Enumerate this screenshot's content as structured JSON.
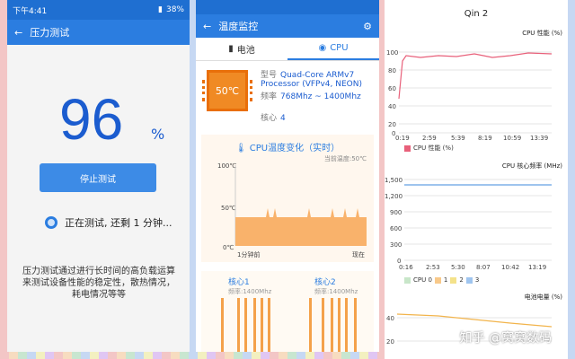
{
  "panel1": {
    "status_time": "下午4:41",
    "status_battery": "38%",
    "title": "压力测试",
    "progress_value": "96",
    "progress_unit": "%",
    "stop_label": "停止测试",
    "testing_text": "正在测试, 还剩 1 分钟...",
    "description": "压力测试通过进行长时间的高负载运算来测试设备性能的稳定性，散热情况，耗电情况等等"
  },
  "panel2": {
    "title": "温度监控",
    "tab_battery": "电池",
    "tab_cpu": "CPU",
    "chip_temp": "50℃",
    "model_label": "型号",
    "model_value": "Quad-Core ARMv7 Processor (VFPv4, NEON)",
    "freq_label": "频率",
    "freq_value": "768Mhz ~ 1400Mhz",
    "cores_label": "核心",
    "cores_value": "4",
    "temp_chart_title": "CPU温度变化（实时）",
    "current_temp": "当前温度:50℃",
    "y_top": "100℃",
    "y_mid": "50℃",
    "y_bot": "0℃",
    "x_left": "1分钟前",
    "x_right": "现在",
    "core1": "核心1",
    "core1_freq": "频率:1400Mhz",
    "core2": "核心2",
    "core2_freq": "频率:1400Mhz"
  },
  "panel3": {
    "title": "Qin 2",
    "chart1_title": "CPU 性能 (%)",
    "chart1_legend": "CPU 性能 (%)",
    "chart1_xticks": [
      "0:19",
      "2:59",
      "5:39",
      "8:19",
      "10:59",
      "13:39"
    ],
    "chart1_yticks": [
      "100",
      "80",
      "60",
      "40",
      "20",
      "0"
    ],
    "chart2_title": "CPU 核心频率 (MHz)",
    "chart2_xticks": [
      "0:16",
      "2:53",
      "5:30",
      "8:07",
      "10:42",
      "13:19"
    ],
    "chart2_yticks": [
      "1,500",
      "1,200",
      "900",
      "600",
      "300",
      "0"
    ],
    "chart2_legend": [
      "CPU 0",
      "1",
      "2",
      "3"
    ],
    "chart3_title": "电池电量 (%)",
    "chart3_yticks": [
      "40",
      "20"
    ],
    "watermark": "知乎 @窝窝数码"
  },
  "colors": {
    "accent": "#2b7de0",
    "chip": "#f08a24",
    "perf_line": "#e8607a",
    "freq_line": "#7fb0e8",
    "battery_line": "#f2b44c"
  }
}
